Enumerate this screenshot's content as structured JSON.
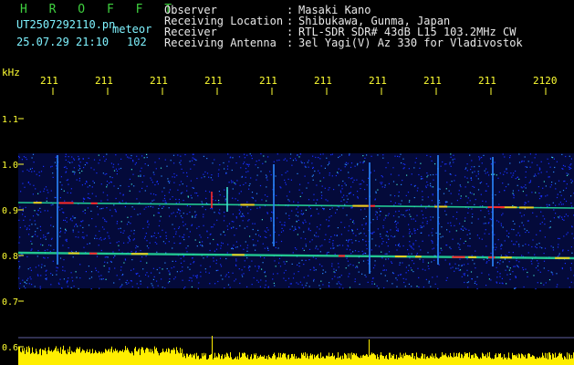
{
  "header": {
    "brand": "H R O F F T",
    "filename": "UT2507292110.pn",
    "mode": "meteor",
    "date_time": "25.07.29 21:10",
    "count": "102"
  },
  "info": {
    "rows": [
      {
        "label": "Observer",
        "sep": ":",
        "value": "Masaki Kano"
      },
      {
        "label": "Receiving Location",
        "sep": ":",
        "value": "Shibukawa, Gunma, Japan"
      },
      {
        "label": "Receiver",
        "sep": ":",
        "value": "RTL-SDR SDR# 43dB L15 103.2MHz CW"
      },
      {
        "label": "Receiving Antenna",
        "sep": ":",
        "value": "3el Yagi(V) Az 330 for Vladivostok"
      }
    ]
  },
  "chart_data": {
    "type": "heatmap",
    "ylabel": "kHz",
    "yticks": [
      "1.1",
      "1.0",
      "0.9",
      "0.8",
      "0.7",
      "0.6"
    ],
    "xticks": [
      "211",
      "211",
      "211",
      "211",
      "211",
      "211",
      "211",
      "211",
      "211",
      "2120"
    ],
    "signal_bands_khz": [
      0.91,
      0.8
    ],
    "colors": {
      "ticks": "#ffff33",
      "noise": "#1830ff",
      "band": "#28e8a0",
      "hot": "#ff2a2a",
      "power_bar": "#ffee00"
    }
  }
}
